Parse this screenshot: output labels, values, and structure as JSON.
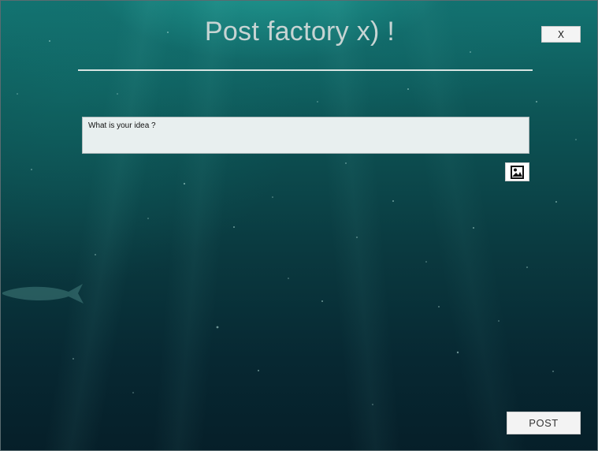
{
  "window": {
    "title": "Post factory x) !",
    "close_label": "X"
  },
  "composer": {
    "placeholder": "What is your idea ?",
    "value": ""
  },
  "attach_image": {
    "icon": "image-icon"
  },
  "actions": {
    "post_label": "POST"
  },
  "colors": {
    "background_top": "#127371",
    "background_bottom": "#061f29",
    "title_text": "#c7d4d3",
    "divider": "#d7e4e2",
    "input_background": "#e8efef",
    "button_background": "#f3f3f3"
  }
}
